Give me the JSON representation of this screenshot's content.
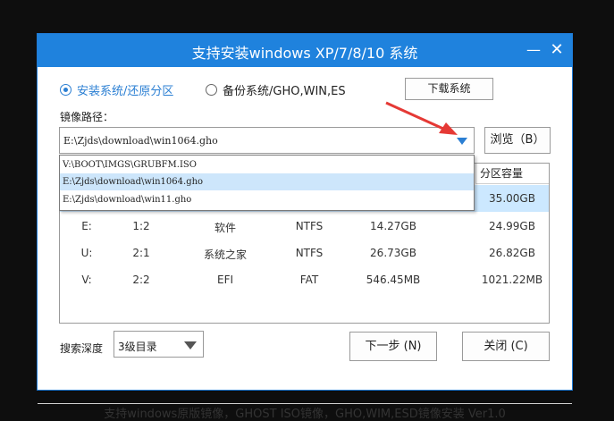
{
  "window": {
    "title": "支持安装windows XP/7/8/10 系统",
    "minimize_glyph": "—",
    "close_glyph": "✕"
  },
  "mode": {
    "option_install": "安装系统/还原分区",
    "option_backup": "备份系统/GHO,WIN,ES",
    "selected": "install"
  },
  "download_button": "下载系统",
  "image_path": {
    "label": "镜像路径：",
    "value": "E:\\Zjds\\download\\win1064.gho",
    "browse_button": "浏览（B）",
    "options": [
      "V:\\BOOT\\IMGS\\GRUBFM.ISO",
      "E:\\Zjds\\download\\win1064.gho",
      "E:\\Zjds\\download\\win11.gho"
    ],
    "selected_index": 1
  },
  "partition_table": {
    "visible_header": "分区容量",
    "selected_row": 0,
    "rows": [
      [
        "",
        "",
        "",
        "",
        "",
        "35.00GB"
      ],
      [
        "E:",
        "1:2",
        "软件",
        "NTFS",
        "14.27GB",
        "24.99GB"
      ],
      [
        "U:",
        "2:1",
        "系统之家",
        "NTFS",
        "26.73GB",
        "26.82GB"
      ],
      [
        "V:",
        "2:2",
        "EFI",
        "FAT",
        "546.45MB",
        "1021.22MB"
      ]
    ]
  },
  "search_depth": {
    "label": "搜索深度",
    "value": "3级目录"
  },
  "buttons": {
    "next": "下一步 (N)",
    "close": "关闭 (C)"
  },
  "footer_text": "支持windows原版镜像，GHOST ISO镜像，GHO,WIM,ESD镜像安装 Ver1.0",
  "colors": {
    "title_bar": "#1f82dd",
    "accent": "#2b7fd3",
    "selection": "#cce8ff",
    "annotation_arrow": "#e53935"
  }
}
